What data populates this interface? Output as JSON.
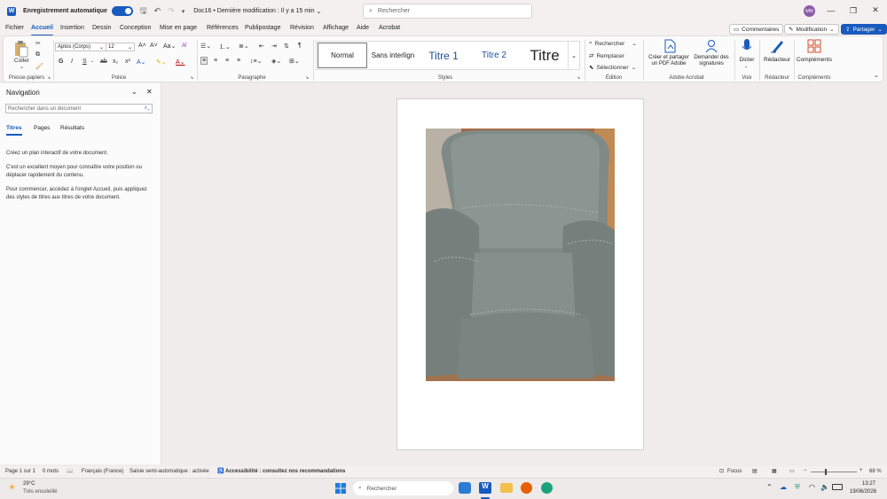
{
  "titlebar": {
    "autosave_label": "Enregistrement automatique",
    "doc_title": "Doc16 • Dernière modification : Il y a 15 min",
    "search_placeholder": "Rechercher",
    "user_initials": "MN"
  },
  "menu": {
    "tabs": [
      "Fichier",
      "Accueil",
      "Insertion",
      "Dessin",
      "Conception",
      "Mise en page",
      "Références",
      "Publipostage",
      "Révision",
      "Affichage",
      "Aide",
      "Acrobat"
    ],
    "comments": "Commentaires",
    "editing": "Modification",
    "share": "Partager"
  },
  "ribbon": {
    "clipboard": {
      "paste": "Coller",
      "label": "Presse-papiers"
    },
    "font": {
      "name": "Aptos (Corps)",
      "size": "12",
      "label": "Police",
      "bold": "G",
      "italic": "I",
      "underline": "S"
    },
    "paragraph": {
      "label": "Paragraphe"
    },
    "styles": {
      "items": [
        "Normal",
        "Sans interlign",
        "Titre 1",
        "Titre 2",
        "Titre"
      ],
      "label": "Styles"
    },
    "editing": {
      "find": "Rechercher",
      "replace": "Remplacer",
      "select": "Sélectionner",
      "label": "Édition"
    },
    "acrobat": {
      "create": "Créer et partager un PDF Adobe",
      "sign": "Demander des signatures",
      "label": "Adobe Acrobat"
    },
    "voice": {
      "dictate": "Dicter",
      "label": "Voix"
    },
    "editor": {
      "name": "Rédacteur",
      "label": "Rédacteur"
    },
    "addins": {
      "name": "Compléments",
      "label": "Compléments"
    }
  },
  "nav": {
    "title": "Navigation",
    "search_placeholder": "Rechercher dans un document",
    "tabs": [
      "Titres",
      "Pages",
      "Résultats"
    ],
    "p1": "Créez un plan interactif de votre document.",
    "p2": "C'est un excellent moyen pour connaître votre position ou déplacer rapidement du contenu.",
    "p3": "Pour commencer, accédez à l'onglet Accueil, puis appliquez des styles de titres aux titres de votre document."
  },
  "status": {
    "page": "Page 1 sur 1",
    "words": "0 mots",
    "language": "Français (France)",
    "autocomplete": "Saisie semi-automatique : activée",
    "accessibility": "Accessibilité : consultez nos recommandations",
    "focus": "Focus",
    "zoom": "68 %"
  },
  "taskbar": {
    "temp": "29°C",
    "weather": "Très ensoleillé",
    "search": "Rechercher",
    "time": "13:27",
    "date": "19/06/2026"
  },
  "colors": {
    "accent": "#185abd"
  }
}
